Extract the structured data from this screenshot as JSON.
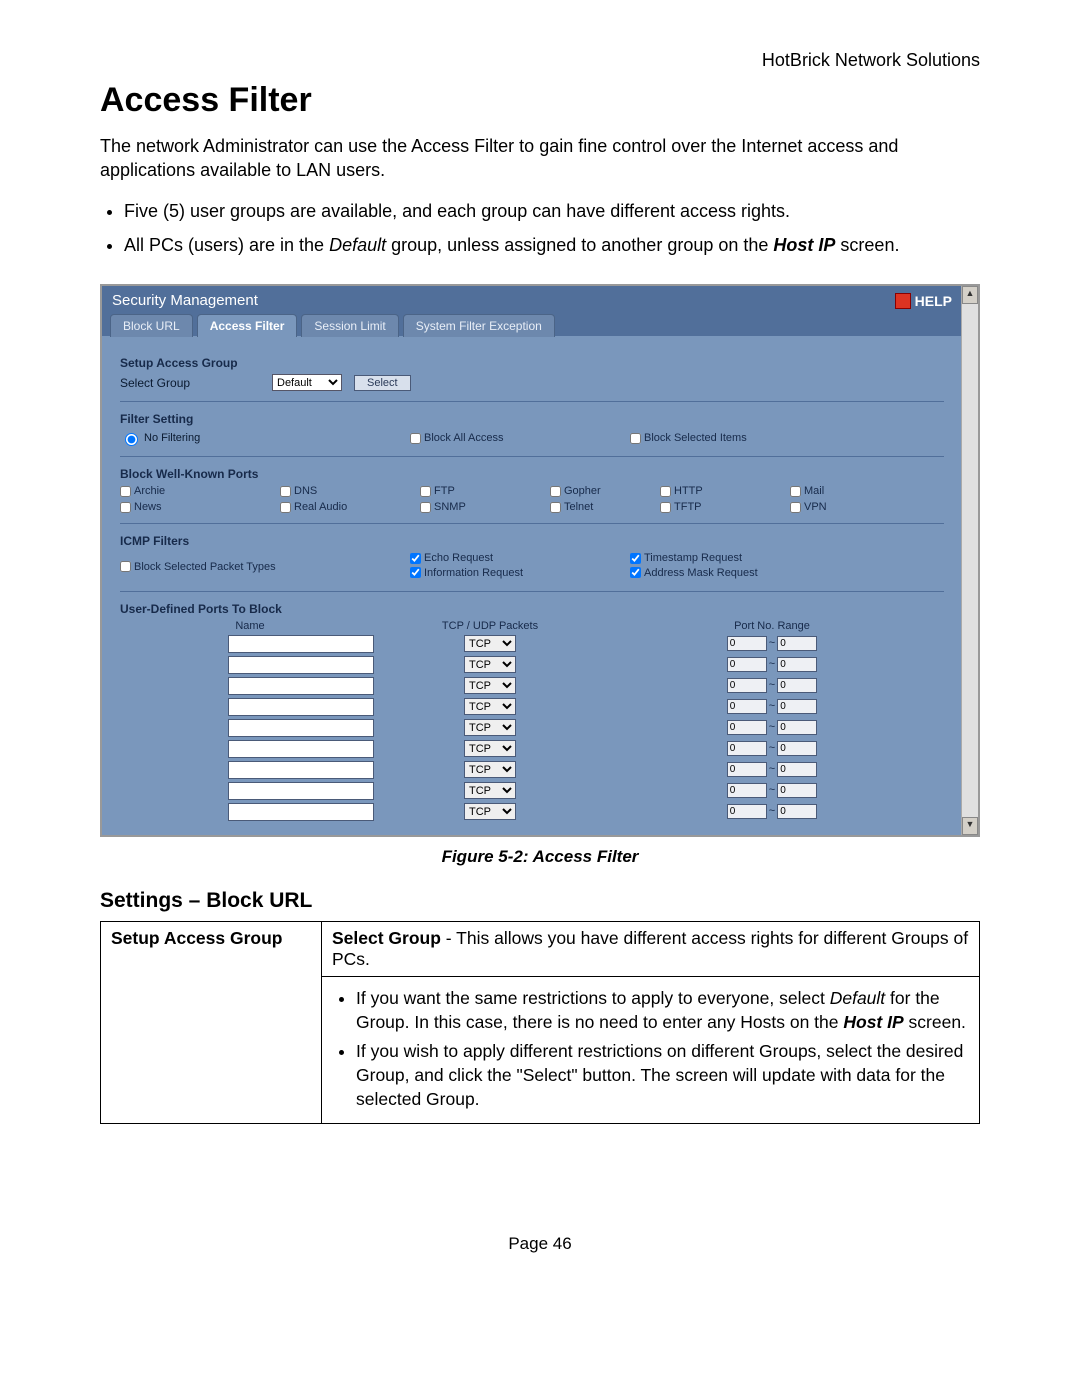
{
  "header": {
    "vendor": "HotBrick Network Solutions",
    "page_number": "Page 46"
  },
  "doc": {
    "title": "Access Filter",
    "intro": "The network Administrator can use the Access Filter to gain fine control over the Internet access and applications available to LAN users.",
    "bullet1": "Five (5) user groups are available, and each group can have different access rights.",
    "bullet2_a": "All PCs (users) are in the ",
    "bullet2_b": "Default",
    "bullet2_c": " group, unless assigned to another group on the ",
    "bullet2_d": "Host IP",
    "bullet2_e": " screen.",
    "caption": "Figure 5-2: Access Filter",
    "subheading": "Settings – Block URL"
  },
  "panel": {
    "title": "Security Management",
    "help": "HELP",
    "tabs": {
      "block_url": "Block URL",
      "access_filter": "Access Filter",
      "session_limit": "Session Limit",
      "system_filter": "System Filter Exception"
    },
    "setup_group_label": "Setup Access Group",
    "select_group_label": "Select Group",
    "group_options": [
      "Default"
    ],
    "group_selected": "Default",
    "select_btn": "Select",
    "filter_setting_label": "Filter Setting",
    "filter_options": {
      "no_filtering": "No Filtering",
      "block_all": "Block All Access",
      "block_selected": "Block Selected Items"
    },
    "wellknown_label": "Block Well-Known Ports",
    "wellknown": {
      "archie": "Archie",
      "dns": "DNS",
      "ftp": "FTP",
      "gopher": "Gopher",
      "http": "HTTP",
      "mail": "Mail",
      "news": "News",
      "realaudio": "Real Audio",
      "snmp": "SNMP",
      "telnet": "Telnet",
      "tftp": "TFTP",
      "vpn": "VPN"
    },
    "icmp_label": "ICMP Filters",
    "icmp": {
      "block_types": "Block Selected Packet Types",
      "echo": "Echo Request",
      "info": "Information Request",
      "timestamp": "Timestamp Request",
      "addrmask": "Address Mask Request"
    },
    "userports_label": "User-Defined Ports To Block",
    "userports_headers": {
      "name": "Name",
      "packets": "TCP / UDP Packets",
      "range": "Port No. Range"
    },
    "proto_option": "TCP",
    "port_zero": "0",
    "tilde": "~"
  },
  "table": {
    "left": "Setup Access Group",
    "row1_a": "Select Group",
    "row1_b": " - This allows you have different access rights for different Groups of PCs.",
    "li1_a": "If you want the same restrictions to apply to everyone, select ",
    "li1_b": "Default",
    "li1_c": " for the Group. In this case, there is no need to enter any Hosts on the ",
    "li1_d": "Host IP",
    "li1_e": " screen.",
    "li2": "If you wish to apply different restrictions on different Groups, select the desired Group, and click the \"Select\" button. The screen will update with data for the selected Group."
  }
}
